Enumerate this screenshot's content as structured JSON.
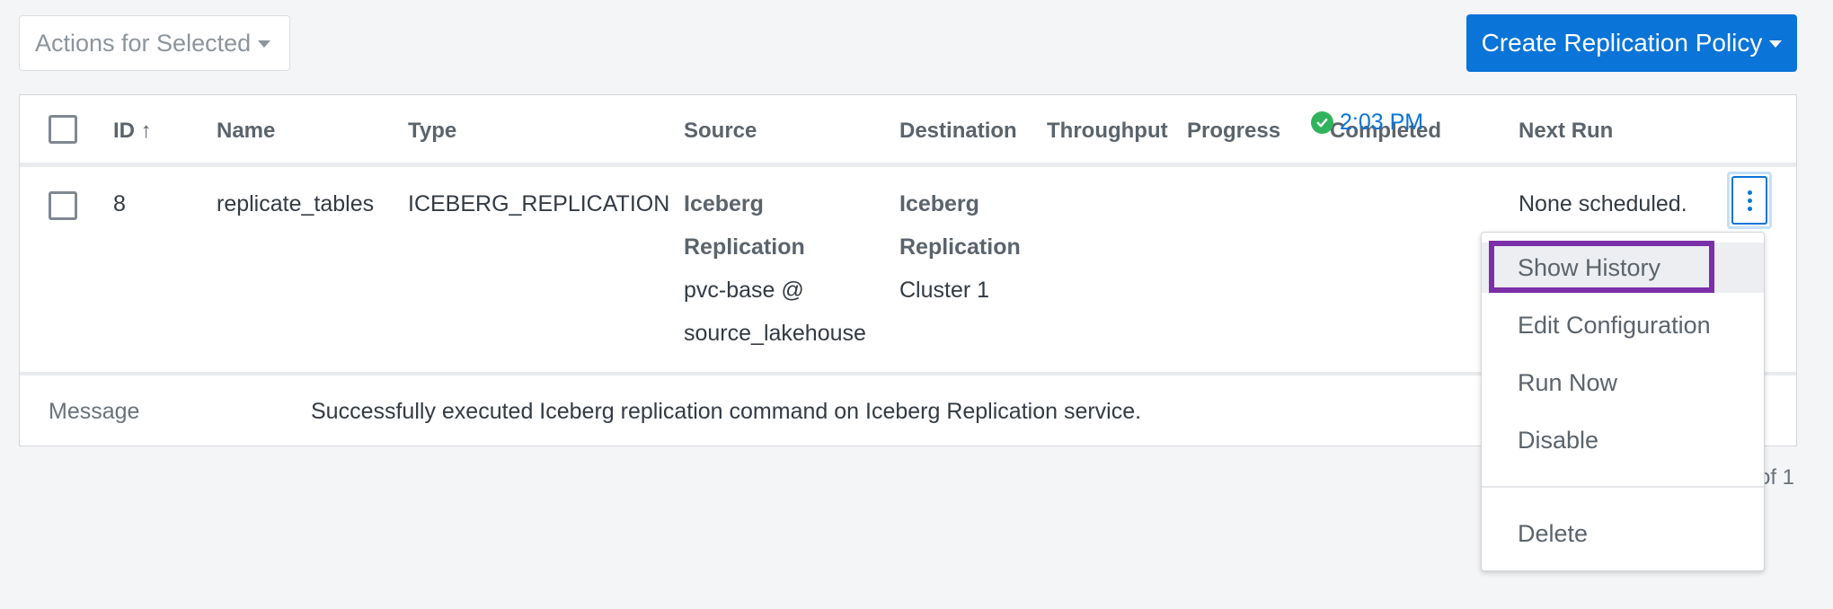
{
  "toolbar": {
    "actions_label": "Actions for Selected",
    "create_label": "Create Replication Policy"
  },
  "table": {
    "headers": {
      "id": "ID ↑",
      "name": "Name",
      "type": "Type",
      "source": "Source",
      "destination": "Destination",
      "throughput": "Throughput",
      "progress": "Progress",
      "completed": "Completed",
      "next_run": "Next Run"
    },
    "row": {
      "id": "8",
      "name": "replicate_tables",
      "type": "ICEBERG_REPLICATION",
      "source_line1": "Iceberg",
      "source_line2": "Replication",
      "source_line3": "pvc-base @",
      "source_line4": "source_lakehouse",
      "dest_line1": "Iceberg",
      "dest_line2": "Replication",
      "dest_line3": "Cluster 1",
      "completed": "2:03 PM",
      "next_run": "None scheduled."
    },
    "message_label": "Message",
    "message_text": "Successfully executed Iceberg replication command on Iceberg Replication service."
  },
  "pager": {
    "text": "of 1"
  },
  "menu": {
    "items": [
      "Show History",
      "Edit Configuration",
      "Run Now",
      "Disable",
      "Delete"
    ]
  },
  "colors": {
    "primary": "#0a74d8",
    "success": "#2fb35c",
    "highlight": "#7b2fa8"
  }
}
